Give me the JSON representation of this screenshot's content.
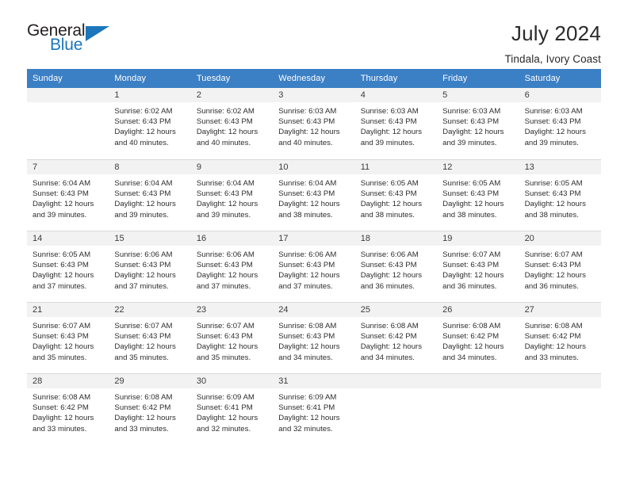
{
  "logo": {
    "primary_text": "General",
    "secondary_text": "Blue",
    "triangle_icon": "triangle-icon",
    "primary_color": "#231f20",
    "secondary_color": "#1b76bc"
  },
  "header": {
    "title": "July 2024",
    "subtitle": "Tindala, Ivory Coast"
  },
  "theme": {
    "header_bg": "#3b7fc4",
    "header_text": "#ffffff",
    "day_band_bg": "#f2f2f2",
    "cell_bg": "#ffffff",
    "row_divider": "#d8d8d8"
  },
  "weekdays": [
    "Sunday",
    "Monday",
    "Tuesday",
    "Wednesday",
    "Thursday",
    "Friday",
    "Saturday"
  ],
  "weeks": [
    [
      {
        "day": "",
        "sunrise": "",
        "sunset": "",
        "daylight1": "",
        "daylight2": ""
      },
      {
        "day": "1",
        "sunrise": "Sunrise: 6:02 AM",
        "sunset": "Sunset: 6:43 PM",
        "daylight1": "Daylight: 12 hours",
        "daylight2": "and 40 minutes."
      },
      {
        "day": "2",
        "sunrise": "Sunrise: 6:02 AM",
        "sunset": "Sunset: 6:43 PM",
        "daylight1": "Daylight: 12 hours",
        "daylight2": "and 40 minutes."
      },
      {
        "day": "3",
        "sunrise": "Sunrise: 6:03 AM",
        "sunset": "Sunset: 6:43 PM",
        "daylight1": "Daylight: 12 hours",
        "daylight2": "and 40 minutes."
      },
      {
        "day": "4",
        "sunrise": "Sunrise: 6:03 AM",
        "sunset": "Sunset: 6:43 PM",
        "daylight1": "Daylight: 12 hours",
        "daylight2": "and 39 minutes."
      },
      {
        "day": "5",
        "sunrise": "Sunrise: 6:03 AM",
        "sunset": "Sunset: 6:43 PM",
        "daylight1": "Daylight: 12 hours",
        "daylight2": "and 39 minutes."
      },
      {
        "day": "6",
        "sunrise": "Sunrise: 6:03 AM",
        "sunset": "Sunset: 6:43 PM",
        "daylight1": "Daylight: 12 hours",
        "daylight2": "and 39 minutes."
      }
    ],
    [
      {
        "day": "7",
        "sunrise": "Sunrise: 6:04 AM",
        "sunset": "Sunset: 6:43 PM",
        "daylight1": "Daylight: 12 hours",
        "daylight2": "and 39 minutes."
      },
      {
        "day": "8",
        "sunrise": "Sunrise: 6:04 AM",
        "sunset": "Sunset: 6:43 PM",
        "daylight1": "Daylight: 12 hours",
        "daylight2": "and 39 minutes."
      },
      {
        "day": "9",
        "sunrise": "Sunrise: 6:04 AM",
        "sunset": "Sunset: 6:43 PM",
        "daylight1": "Daylight: 12 hours",
        "daylight2": "and 39 minutes."
      },
      {
        "day": "10",
        "sunrise": "Sunrise: 6:04 AM",
        "sunset": "Sunset: 6:43 PM",
        "daylight1": "Daylight: 12 hours",
        "daylight2": "and 38 minutes."
      },
      {
        "day": "11",
        "sunrise": "Sunrise: 6:05 AM",
        "sunset": "Sunset: 6:43 PM",
        "daylight1": "Daylight: 12 hours",
        "daylight2": "and 38 minutes."
      },
      {
        "day": "12",
        "sunrise": "Sunrise: 6:05 AM",
        "sunset": "Sunset: 6:43 PM",
        "daylight1": "Daylight: 12 hours",
        "daylight2": "and 38 minutes."
      },
      {
        "day": "13",
        "sunrise": "Sunrise: 6:05 AM",
        "sunset": "Sunset: 6:43 PM",
        "daylight1": "Daylight: 12 hours",
        "daylight2": "and 38 minutes."
      }
    ],
    [
      {
        "day": "14",
        "sunrise": "Sunrise: 6:05 AM",
        "sunset": "Sunset: 6:43 PM",
        "daylight1": "Daylight: 12 hours",
        "daylight2": "and 37 minutes."
      },
      {
        "day": "15",
        "sunrise": "Sunrise: 6:06 AM",
        "sunset": "Sunset: 6:43 PM",
        "daylight1": "Daylight: 12 hours",
        "daylight2": "and 37 minutes."
      },
      {
        "day": "16",
        "sunrise": "Sunrise: 6:06 AM",
        "sunset": "Sunset: 6:43 PM",
        "daylight1": "Daylight: 12 hours",
        "daylight2": "and 37 minutes."
      },
      {
        "day": "17",
        "sunrise": "Sunrise: 6:06 AM",
        "sunset": "Sunset: 6:43 PM",
        "daylight1": "Daylight: 12 hours",
        "daylight2": "and 37 minutes."
      },
      {
        "day": "18",
        "sunrise": "Sunrise: 6:06 AM",
        "sunset": "Sunset: 6:43 PM",
        "daylight1": "Daylight: 12 hours",
        "daylight2": "and 36 minutes."
      },
      {
        "day": "19",
        "sunrise": "Sunrise: 6:07 AM",
        "sunset": "Sunset: 6:43 PM",
        "daylight1": "Daylight: 12 hours",
        "daylight2": "and 36 minutes."
      },
      {
        "day": "20",
        "sunrise": "Sunrise: 6:07 AM",
        "sunset": "Sunset: 6:43 PM",
        "daylight1": "Daylight: 12 hours",
        "daylight2": "and 36 minutes."
      }
    ],
    [
      {
        "day": "21",
        "sunrise": "Sunrise: 6:07 AM",
        "sunset": "Sunset: 6:43 PM",
        "daylight1": "Daylight: 12 hours",
        "daylight2": "and 35 minutes."
      },
      {
        "day": "22",
        "sunrise": "Sunrise: 6:07 AM",
        "sunset": "Sunset: 6:43 PM",
        "daylight1": "Daylight: 12 hours",
        "daylight2": "and 35 minutes."
      },
      {
        "day": "23",
        "sunrise": "Sunrise: 6:07 AM",
        "sunset": "Sunset: 6:43 PM",
        "daylight1": "Daylight: 12 hours",
        "daylight2": "and 35 minutes."
      },
      {
        "day": "24",
        "sunrise": "Sunrise: 6:08 AM",
        "sunset": "Sunset: 6:43 PM",
        "daylight1": "Daylight: 12 hours",
        "daylight2": "and 34 minutes."
      },
      {
        "day": "25",
        "sunrise": "Sunrise: 6:08 AM",
        "sunset": "Sunset: 6:42 PM",
        "daylight1": "Daylight: 12 hours",
        "daylight2": "and 34 minutes."
      },
      {
        "day": "26",
        "sunrise": "Sunrise: 6:08 AM",
        "sunset": "Sunset: 6:42 PM",
        "daylight1": "Daylight: 12 hours",
        "daylight2": "and 34 minutes."
      },
      {
        "day": "27",
        "sunrise": "Sunrise: 6:08 AM",
        "sunset": "Sunset: 6:42 PM",
        "daylight1": "Daylight: 12 hours",
        "daylight2": "and 33 minutes."
      }
    ],
    [
      {
        "day": "28",
        "sunrise": "Sunrise: 6:08 AM",
        "sunset": "Sunset: 6:42 PM",
        "daylight1": "Daylight: 12 hours",
        "daylight2": "and 33 minutes."
      },
      {
        "day": "29",
        "sunrise": "Sunrise: 6:08 AM",
        "sunset": "Sunset: 6:42 PM",
        "daylight1": "Daylight: 12 hours",
        "daylight2": "and 33 minutes."
      },
      {
        "day": "30",
        "sunrise": "Sunrise: 6:09 AM",
        "sunset": "Sunset: 6:41 PM",
        "daylight1": "Daylight: 12 hours",
        "daylight2": "and 32 minutes."
      },
      {
        "day": "31",
        "sunrise": "Sunrise: 6:09 AM",
        "sunset": "Sunset: 6:41 PM",
        "daylight1": "Daylight: 12 hours",
        "daylight2": "and 32 minutes."
      },
      {
        "day": "",
        "sunrise": "",
        "sunset": "",
        "daylight1": "",
        "daylight2": ""
      },
      {
        "day": "",
        "sunrise": "",
        "sunset": "",
        "daylight1": "",
        "daylight2": ""
      },
      {
        "day": "",
        "sunrise": "",
        "sunset": "",
        "daylight1": "",
        "daylight2": ""
      }
    ]
  ]
}
